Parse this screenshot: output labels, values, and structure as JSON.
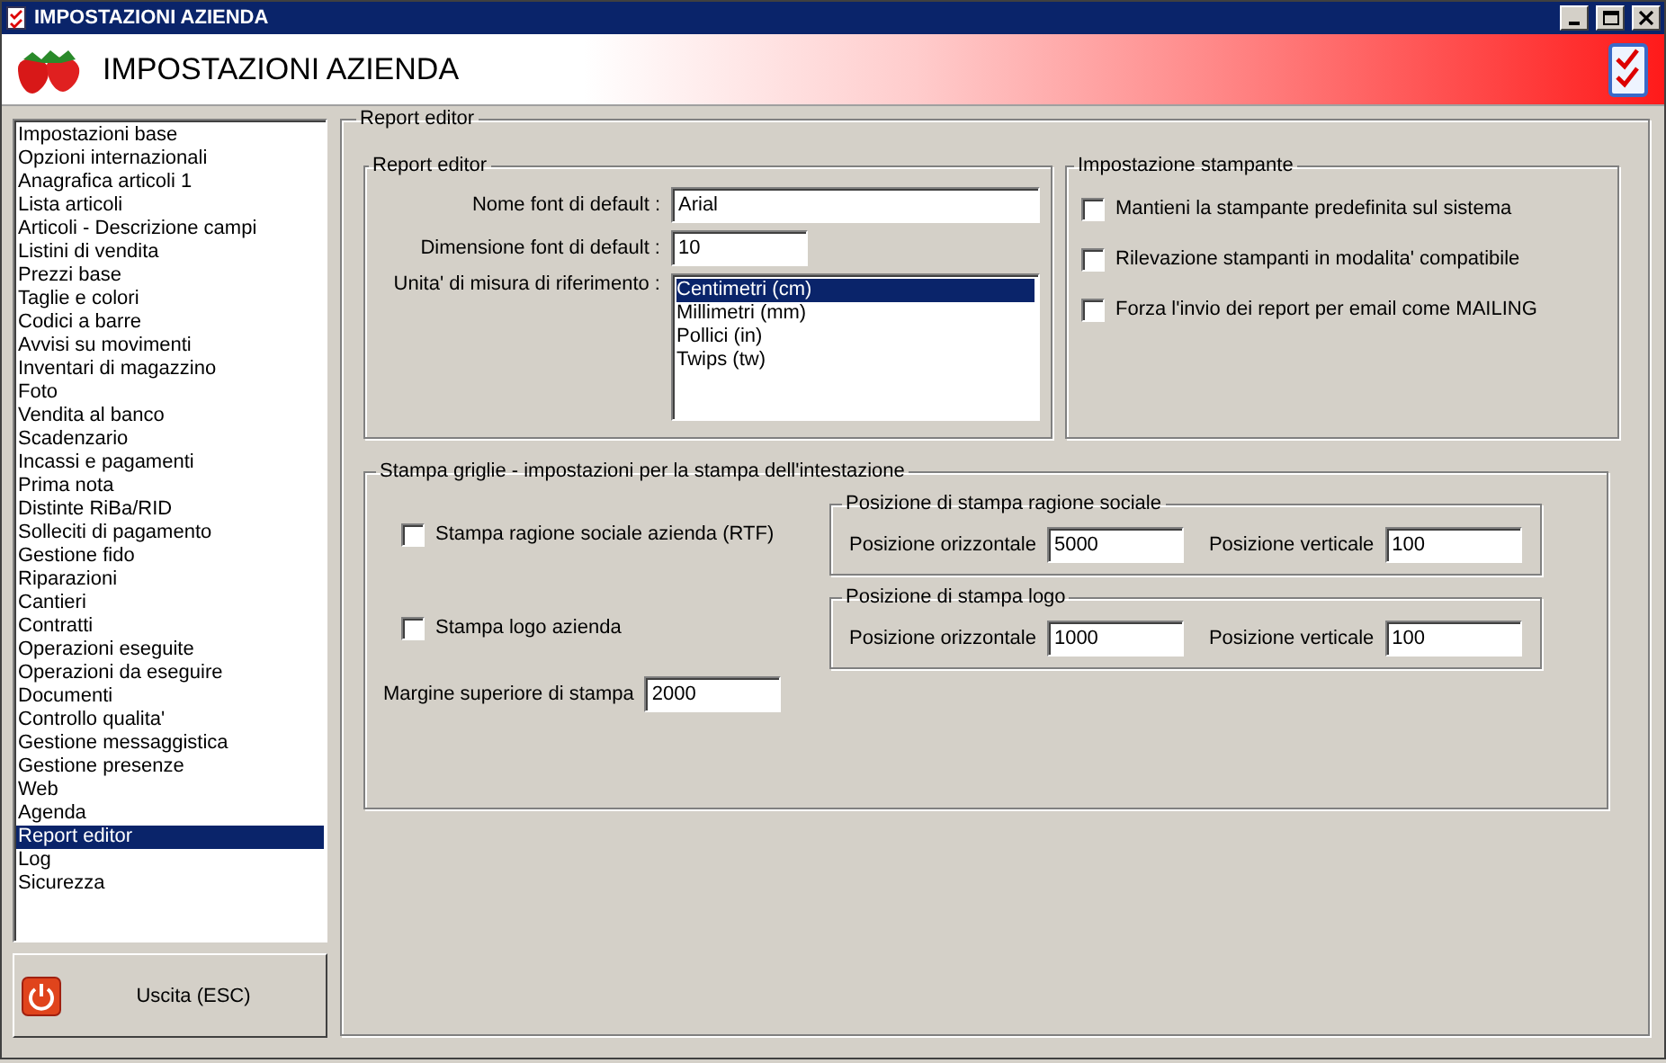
{
  "window": {
    "title": "IMPOSTAZIONI AZIENDA"
  },
  "header": {
    "title": "IMPOSTAZIONI AZIENDA"
  },
  "sidebar": {
    "items": [
      {
        "label": "Impostazioni base",
        "selected": false
      },
      {
        "label": "Opzioni internazionali",
        "selected": false
      },
      {
        "label": "Anagrafica articoli 1",
        "selected": false
      },
      {
        "label": "Lista articoli",
        "selected": false
      },
      {
        "label": "Articoli - Descrizione campi",
        "selected": false
      },
      {
        "label": "Listini di vendita",
        "selected": false
      },
      {
        "label": "Prezzi base",
        "selected": false
      },
      {
        "label": "Taglie e colori",
        "selected": false
      },
      {
        "label": "Codici a barre",
        "selected": false
      },
      {
        "label": "Avvisi su movimenti",
        "selected": false
      },
      {
        "label": "Inventari di magazzino",
        "selected": false
      },
      {
        "label": "Foto",
        "selected": false
      },
      {
        "label": "Vendita al banco",
        "selected": false
      },
      {
        "label": "Scadenzario",
        "selected": false
      },
      {
        "label": "Incassi e pagamenti",
        "selected": false
      },
      {
        "label": "Prima nota",
        "selected": false
      },
      {
        "label": "Distinte RiBa/RID",
        "selected": false
      },
      {
        "label": "Solleciti di pagamento",
        "selected": false
      },
      {
        "label": "Gestione fido",
        "selected": false
      },
      {
        "label": "Riparazioni",
        "selected": false
      },
      {
        "label": "Cantieri",
        "selected": false
      },
      {
        "label": "Contratti",
        "selected": false
      },
      {
        "label": "Operazioni eseguite",
        "selected": false
      },
      {
        "label": "Operazioni da eseguire",
        "selected": false
      },
      {
        "label": "Documenti",
        "selected": false
      },
      {
        "label": "Controllo qualita'",
        "selected": false
      },
      {
        "label": "Gestione messaggistica",
        "selected": false
      },
      {
        "label": "Gestione presenze",
        "selected": false
      },
      {
        "label": "Web",
        "selected": false
      },
      {
        "label": "Agenda",
        "selected": false
      },
      {
        "label": "Report editor",
        "selected": true
      },
      {
        "label": "Log",
        "selected": false
      },
      {
        "label": "Sicurezza",
        "selected": false
      }
    ]
  },
  "exit_button": {
    "label": "Uscita (ESC)"
  },
  "panel": {
    "title": "Report editor"
  },
  "report_editor": {
    "title": "Report editor",
    "fields": [
      {
        "label": "Nome font di default :",
        "value": "Arial",
        "kind": "wide"
      },
      {
        "label": "Dimensione font di default :",
        "value": "10",
        "kind": "short"
      }
    ],
    "units": {
      "label": "Unita' di misura di riferimento :",
      "options": [
        {
          "label": "Centimetri (cm)",
          "selected": true
        },
        {
          "label": "Millimetri (mm)",
          "selected": false
        },
        {
          "label": "Pollici (in)",
          "selected": false
        },
        {
          "label": "Twips (tw)",
          "selected": false
        }
      ]
    }
  },
  "printer_settings": {
    "title": "Impostazione stampante",
    "options": [
      {
        "label": "Mantieni la stampante predefinita sul sistema",
        "checked": false
      },
      {
        "label": "Rilevazione stampanti in modalita' compatibile",
        "checked": false
      },
      {
        "label": "Forza l'invio dei report per email come MAILING",
        "checked": false
      }
    ]
  },
  "grid_print": {
    "title": "Stampa griglie - impostazioni per la stampa dell'intestazione",
    "options": [
      {
        "label": "Stampa ragione sociale azienda (RTF)",
        "checked": false
      },
      {
        "label": "Stampa logo azienda",
        "checked": false
      }
    ],
    "positions": [
      {
        "title": "Posizione di stampa ragione sociale",
        "horizontal_label": "Posizione orizzontale",
        "horizontal_value": "5000",
        "vertical_label": "Posizione verticale",
        "vertical_value": "100"
      },
      {
        "title": "Posizione di stampa logo",
        "horizontal_label": "Posizione orizzontale",
        "horizontal_value": "1000",
        "vertical_label": "Posizione verticale",
        "vertical_value": "100"
      }
    ],
    "top_margin": {
      "label": "Margine superiore di stampa",
      "value": "2000"
    }
  }
}
